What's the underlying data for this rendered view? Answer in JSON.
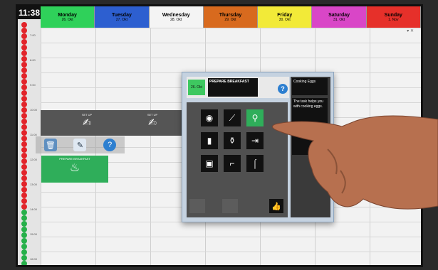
{
  "clock": "11:38",
  "days": [
    {
      "name": "Monday",
      "date": "26. Okt",
      "color": "#2fd15a"
    },
    {
      "name": "Tuesday",
      "date": "27. Okt",
      "color": "#2d5fd0"
    },
    {
      "name": "Wednesday",
      "date": "28. Okt",
      "color": "#f4f4f4"
    },
    {
      "name": "Thursday",
      "date": "29. Okt",
      "color": "#d86a1e"
    },
    {
      "name": "Friday",
      "date": "30. Okt",
      "color": "#f2ea38"
    },
    {
      "name": "Saturday",
      "date": "31. Okt",
      "color": "#d946c7"
    },
    {
      "name": "Sunday",
      "date": "1. Nov",
      "color": "#e6302a"
    }
  ],
  "hours": [
    "7:00",
    "8:00",
    "9:00",
    "10:00",
    "11:00",
    "12:00",
    "13:00",
    "14:00",
    "15:00",
    "16:00"
  ],
  "setup_label": "SET UP",
  "prepare_label": "PREPARE BREAKFAST",
  "dialog": {
    "date": "26. Okt",
    "title": "PREPARE BREAKFAST",
    "help": "?",
    "side_title": "Cooking Eggs",
    "side_desc": "The task helps you with cooking eggs."
  },
  "icons": [
    {
      "name": "eye-icon",
      "glyph": "◉"
    },
    {
      "name": "knife-icon",
      "glyph": "⟋"
    },
    {
      "name": "egg-spoon-icon",
      "glyph": "⚲"
    },
    {
      "name": "cabinet-icon",
      "glyph": "▮"
    },
    {
      "name": "bottle-icon",
      "glyph": "⚱"
    },
    {
      "name": "exit-icon",
      "glyph": "⇥"
    },
    {
      "name": "appliance-icon",
      "glyph": "▣"
    },
    {
      "name": "pan-icon",
      "glyph": "⌐"
    },
    {
      "name": "tap-icon",
      "glyph": "⌠"
    }
  ]
}
